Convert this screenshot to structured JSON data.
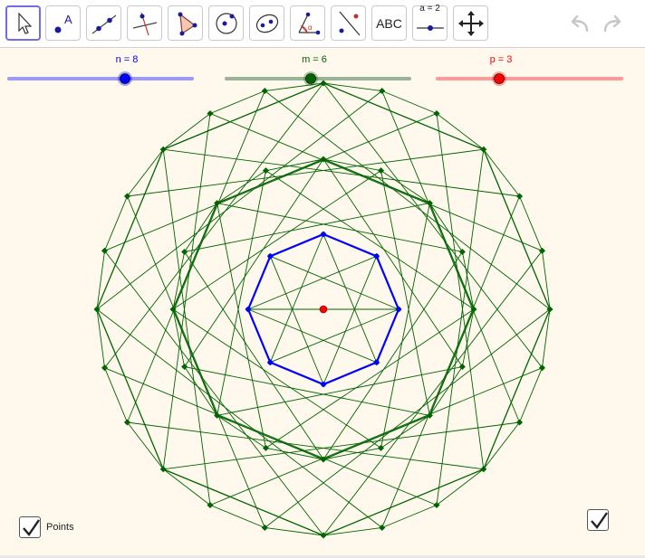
{
  "toolbar": {
    "tools": [
      {
        "name": "move-tool",
        "icon": "cursor-arrow-icon"
      },
      {
        "name": "point-tool",
        "icon": "point-label-icon",
        "glyph": "A"
      },
      {
        "name": "line-tool",
        "icon": "line-through-points-icon"
      },
      {
        "name": "perpendicular-line-tool",
        "icon": "perpendicular-line-icon"
      },
      {
        "name": "polygon-tool",
        "icon": "polygon-icon"
      },
      {
        "name": "circle-tool",
        "icon": "circle-center-point-icon"
      },
      {
        "name": "conic-tool",
        "icon": "ellipse-icon"
      },
      {
        "name": "angle-tool",
        "icon": "angle-icon",
        "glyph": "α"
      },
      {
        "name": "reflect-tool",
        "icon": "reflect-about-line-icon"
      },
      {
        "name": "text-tool",
        "icon": "text-icon",
        "label": "ABC"
      },
      {
        "name": "slider-tool",
        "icon": "slider-icon",
        "label": "a = 2"
      },
      {
        "name": "move-graphics-tool",
        "icon": "move-graphics-view-icon"
      }
    ],
    "undo_icon": "undo-icon",
    "redo_icon": "redo-icon"
  },
  "sliders": [
    {
      "label": "n = 8",
      "color": "#0000ff",
      "track": "#9999ff",
      "value": 8,
      "min": 1,
      "max": 12
    },
    {
      "label": "m = 6",
      "color": "#006400",
      "track": "#99b399",
      "value": 6
    },
    {
      "label": "p = 3",
      "color": "#ff0000",
      "track": "#ff9999",
      "value": 3
    }
  ],
  "figure": {
    "center_color": "#ff0000",
    "polygon_color": "#0000ff",
    "string_color": "#006400",
    "rings": [
      {
        "vertices": 8,
        "step": 3
      },
      {
        "vertices": 16,
        "step": 5
      },
      {
        "vertices": 24,
        "step": 7
      }
    ]
  },
  "checkboxes": [
    {
      "label": "Points",
      "checked": true
    },
    {
      "label": "",
      "checked": true
    }
  ]
}
